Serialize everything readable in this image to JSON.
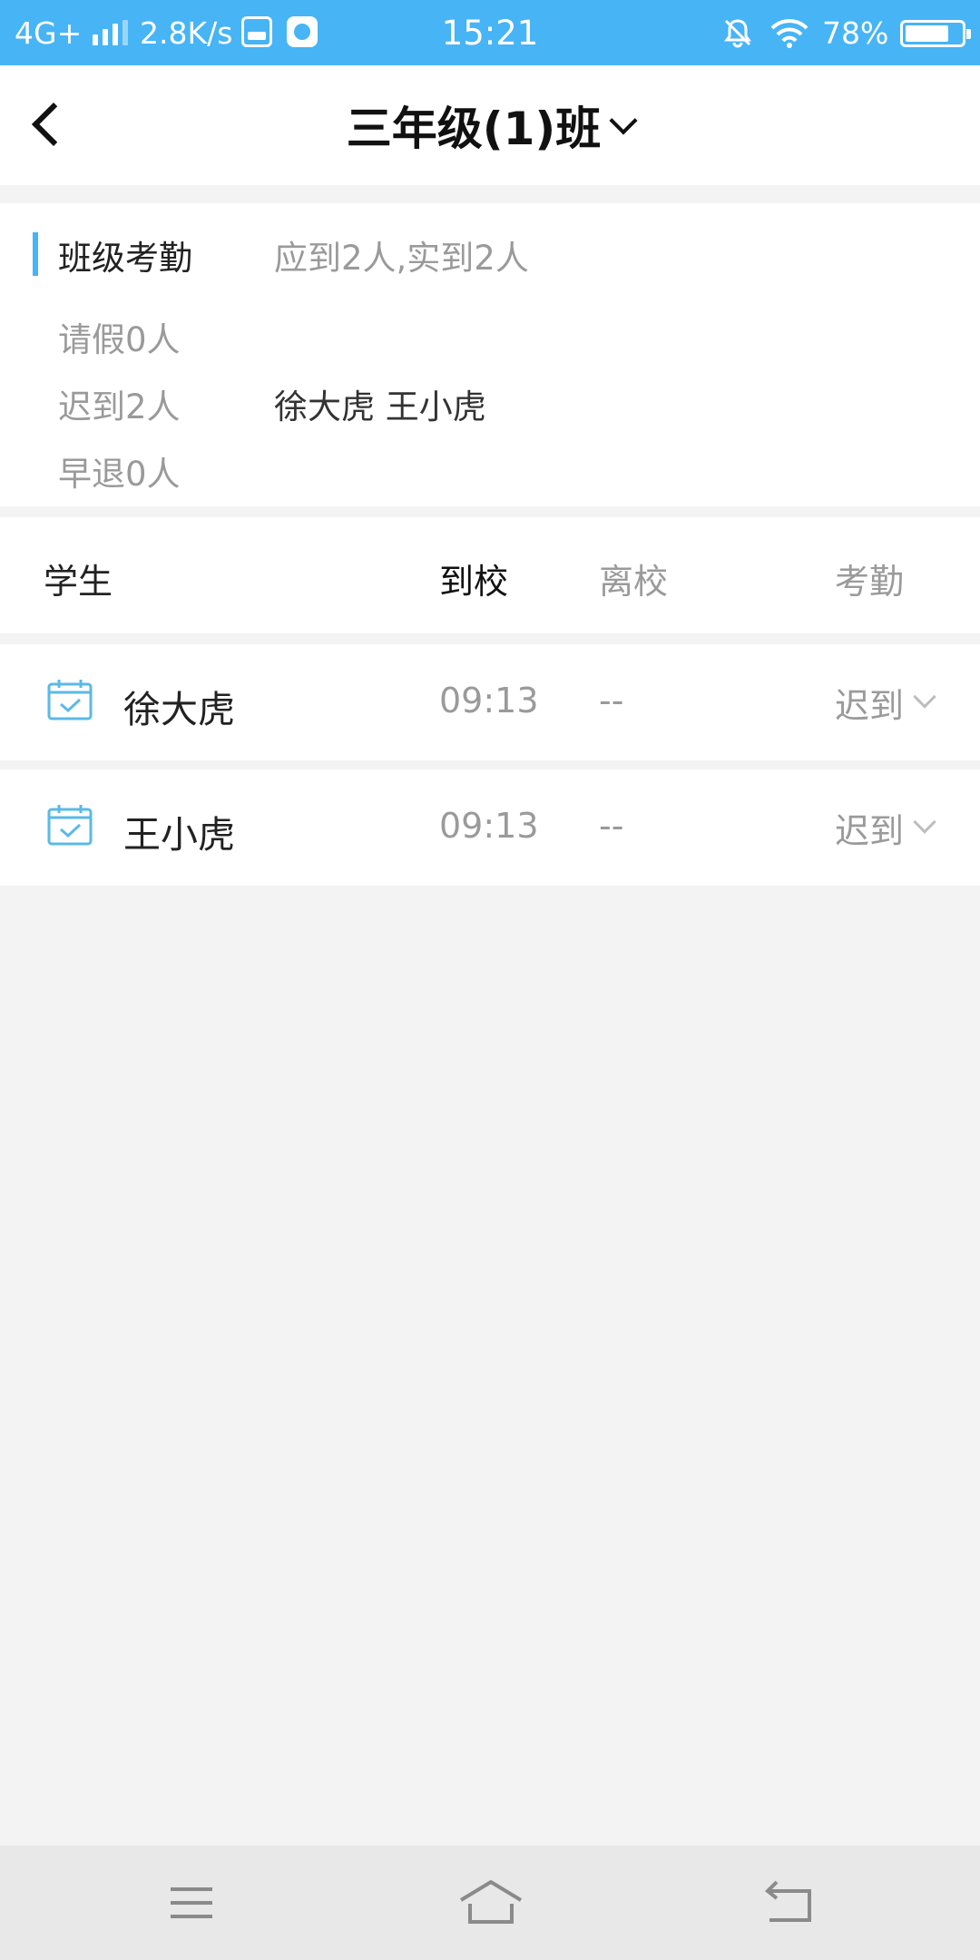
{
  "status_bar": {
    "network": "4G+",
    "speed": "2.8K/s",
    "time": "15:21",
    "battery_text": "78%",
    "battery_level": 0.78
  },
  "header": {
    "class_name": "三年级(1)班"
  },
  "attendance_summary": {
    "title": "班级考勤",
    "expected_actual": "应到2人,实到2人",
    "leave": "请假0人",
    "late": "迟到2人",
    "late_names": "徐大虎 王小虎",
    "early_leave": "早退0人"
  },
  "table": {
    "columns": [
      "学生",
      "到校",
      "离校",
      "考勤"
    ],
    "rows": [
      {
        "name": "徐大虎",
        "arrive": "09:13",
        "leave": "--",
        "status": "迟到"
      },
      {
        "name": "王小虎",
        "arrive": "09:13",
        "leave": "--",
        "status": "迟到"
      }
    ]
  },
  "colors": {
    "status_bar": "#47b4f5",
    "accent": "#47b4f5",
    "icon": "#5bb9e6",
    "background": "#f3f3f4"
  },
  "icons": {
    "back": "chevron-left-icon",
    "class_dropdown": "chevron-down-icon",
    "row_icon": "calendar-check-icon",
    "status_dropdown": "chevron-down-icon",
    "nav": [
      "menu-icon",
      "home-icon",
      "back-icon"
    ]
  }
}
